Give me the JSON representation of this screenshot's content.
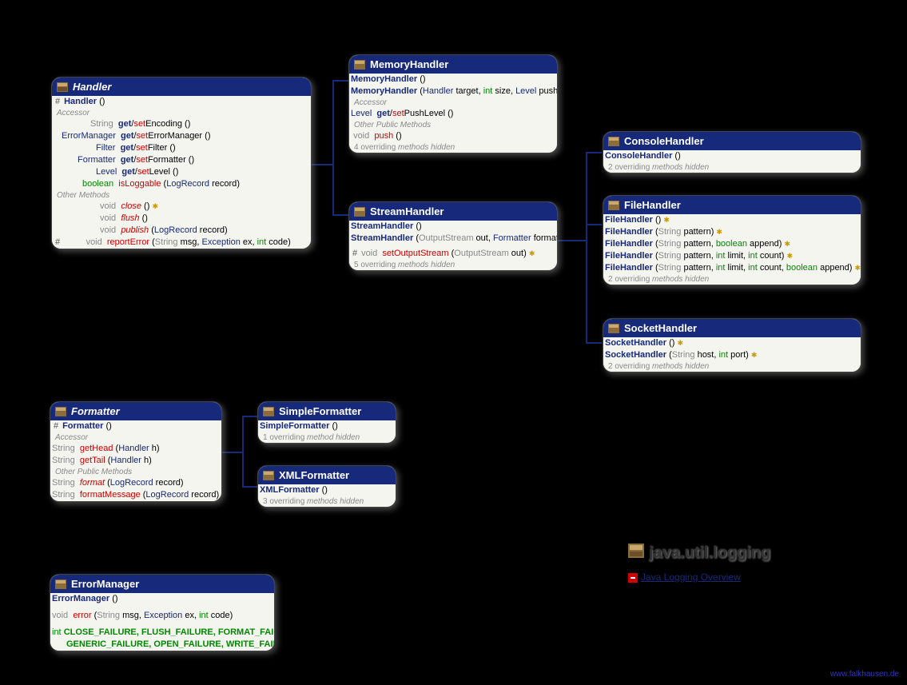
{
  "package": {
    "title": "java.util.logging",
    "link_label": "Java Logging Overview",
    "attribution": "www.falkhausen.de"
  },
  "classes": {
    "Handler": {
      "name": "Handler",
      "abstract": true,
      "ctor_vis": "#",
      "ctor": "Handler",
      "section_accessor": "Accessor",
      "accessors": [
        {
          "ret": "String",
          "name": "Encoding"
        },
        {
          "ret": "ErrorManager",
          "name": "ErrorManager"
        },
        {
          "ret": "Filter",
          "name": "Filter"
        },
        {
          "ret": "Formatter",
          "name": "Formatter"
        },
        {
          "ret": "Level",
          "name": "Level"
        }
      ],
      "bool_method": {
        "ret": "boolean",
        "name": "isLoggable",
        "param_type": "LogRecord",
        "param_name": "record"
      },
      "section_other": "Other Methods",
      "methods": [
        {
          "ret": "void",
          "name": "close",
          "italic": true,
          "exc": true
        },
        {
          "ret": "void",
          "name": "flush",
          "italic": true
        },
        {
          "ret": "void",
          "name": "publish",
          "italic": true,
          "params": [
            {
              "type": "LogRecord",
              "name": "record"
            }
          ]
        }
      ],
      "protected_method": {
        "vis": "#",
        "ret": "void",
        "name": "reportError",
        "params_text": "String msg, Exception ex, int code"
      }
    },
    "MemoryHandler": {
      "name": "MemoryHandler",
      "ctors": [
        {
          "text": "MemoryHandler ()"
        },
        {
          "text": "MemoryHandler (Handler target, int size, Level pushLevel)"
        }
      ],
      "section_accessor": "Accessor",
      "accessor": {
        "ret": "Level",
        "name": "PushLevel"
      },
      "section_other": "Other Public Methods",
      "method": {
        "ret": "void",
        "name": "push"
      },
      "note": "4 overriding methods hidden"
    },
    "StreamHandler": {
      "name": "StreamHandler",
      "ctors": [
        {
          "text": "StreamHandler ()"
        },
        {
          "text": "StreamHandler (OutputStream out, Formatter formatter)"
        }
      ],
      "protected": {
        "vis": "#",
        "ret": "void",
        "name": "setOutputStream",
        "params": "(OutputStream out)",
        "exc": true
      },
      "note": "5 overriding methods hidden"
    },
    "ConsoleHandler": {
      "name": "ConsoleHandler",
      "ctor": "ConsoleHandler ()",
      "note": "2 overriding methods hidden"
    },
    "FileHandler": {
      "name": "FileHandler",
      "ctors": [
        "FileHandler ()",
        "FileHandler (String pattern)",
        "FileHandler (String pattern, boolean append)",
        "FileHandler (String pattern, int limit, int count)",
        "FileHandler (String pattern, int limit, int count, boolean append)"
      ],
      "note": "2 overriding methods hidden"
    },
    "SocketHandler": {
      "name": "SocketHandler",
      "ctors": [
        "SocketHandler ()",
        "SocketHandler (String host, int port)"
      ],
      "note": "2 overriding methods hidden"
    },
    "Formatter": {
      "name": "Formatter",
      "abstract": true,
      "ctor_vis": "#",
      "ctor": "Formatter ()",
      "section_accessor": "Accessor",
      "accessors": [
        {
          "ret": "String",
          "name": "getHead",
          "param": "Handler h"
        },
        {
          "ret": "String",
          "name": "getTail",
          "param": "Handler h"
        }
      ],
      "section_other": "Other Public Methods",
      "methods": [
        {
          "ret": "String",
          "name": "format",
          "italic": true,
          "param": "LogRecord record"
        },
        {
          "ret": "String",
          "name": "formatMessage",
          "param": "LogRecord record"
        }
      ]
    },
    "SimpleFormatter": {
      "name": "SimpleFormatter",
      "ctor": "SimpleFormatter ()",
      "note": "1 overriding method hidden"
    },
    "XMLFormatter": {
      "name": "XMLFormatter",
      "ctor": "XMLFormatter ()",
      "note": "3 overriding methods hidden"
    },
    "ErrorManager": {
      "name": "ErrorManager",
      "ctor": "ErrorManager ()",
      "method": {
        "ret": "void",
        "name": "error",
        "params": "(String msg, Exception ex, int code)"
      },
      "constants_prefix": "int",
      "constants": "CLOSE_FAILURE, FLUSH_FAILURE, FORMAT_FAILURE, GENERIC_FAILURE, OPEN_FAILURE, WRITE_FAILURE"
    }
  }
}
